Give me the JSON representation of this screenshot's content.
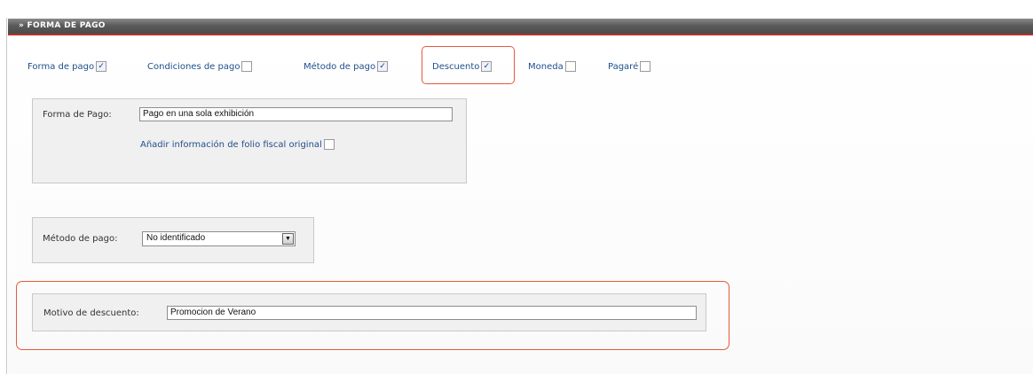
{
  "section": {
    "title": "» FORMA DE PAGO"
  },
  "options": [
    {
      "label": "Forma de pago",
      "checked": true
    },
    {
      "label": "Condiciones de pago",
      "checked": false
    },
    {
      "label": "Método de pago",
      "checked": true
    },
    {
      "label": "Descuento",
      "checked": true
    },
    {
      "label": "Moneda",
      "checked": false
    },
    {
      "label": "Pagaré",
      "checked": false
    }
  ],
  "forma_pago_panel": {
    "label": "Forma de Pago:",
    "value": "Pago en una sola exhibición",
    "folio_label": "Añadir información de folio fiscal original",
    "folio_checked": false
  },
  "metodo_pago_panel": {
    "label": "Método de pago:",
    "selected": "No identificado"
  },
  "descuento_panel": {
    "label": "Motivo de descuento:",
    "value": "Promocion de Verano"
  },
  "colors": {
    "highlight": "#e45a3c",
    "header_bar": "#4a4a4a",
    "link": "#1f4f8a",
    "panel_bg": "#f0f0f0"
  }
}
